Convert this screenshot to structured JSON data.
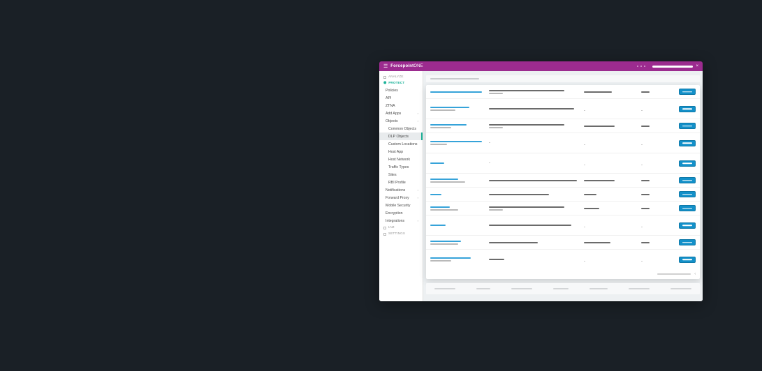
{
  "brand": {
    "bold": "Forcepoint",
    "light": "ONE"
  },
  "sections": {
    "analyze": "ANALYZE",
    "protect": "PROTECT",
    "iam": "IAM",
    "settings": "SETTINGS"
  },
  "nav": {
    "policies": "Policies",
    "api": "API",
    "ztna": "ZTNA",
    "addapps": "Add Apps",
    "objects": "Objects",
    "common": "Common Objects",
    "dlp": "DLP Objects",
    "custom": "Custom Locations",
    "hostapp": "Host App",
    "hostnetwork": "Host Network",
    "traffic": "Traffic Types",
    "sites": "Sites",
    "rbi": "RBI Profile",
    "notifications": "Notifications",
    "forwardproxy": "Forward Proxy",
    "mobilesec": "Mobile Security",
    "encryption": "Encryption",
    "integrations": "Integrations"
  },
  "colors": {
    "brand": "#9c2b8f",
    "accent": "#1eb39a",
    "link": "#36a3d9",
    "button": "#1390c9"
  },
  "rows": [
    {
      "c1": [
        {
          "c": "blue",
          "w": 74
        }
      ],
      "c2": [
        {
          "c": "gray",
          "w": 108
        },
        {
          "c": "light",
          "w": 20
        }
      ],
      "c3": {
        "type": "skel",
        "w": 40
      },
      "c4": {
        "type": "skel",
        "w": 12
      }
    },
    {
      "c1": [
        {
          "c": "blue",
          "w": 56
        },
        {
          "c": "light",
          "w": 36
        }
      ],
      "c2": [
        {
          "c": "gray",
          "w": 122
        }
      ],
      "c3": {
        "type": "dash"
      },
      "c4": {
        "type": "dash"
      }
    },
    {
      "c1": [
        {
          "c": "blue",
          "w": 52
        },
        {
          "c": "light",
          "w": 30
        }
      ],
      "c2": [
        {
          "c": "gray",
          "w": 108
        },
        {
          "c": "light",
          "w": 20
        }
      ],
      "c3": {
        "type": "skel",
        "w": 44
      },
      "c4": {
        "type": "skel",
        "w": 12
      }
    },
    {
      "c1": [
        {
          "c": "blue",
          "w": 74
        },
        {
          "c": "light",
          "w": 24
        }
      ],
      "c2": [],
      "c3": {
        "type": "dash"
      },
      "c4": {
        "type": "dash"
      },
      "c2dash": true
    },
    {
      "c1": [
        {
          "c": "blue",
          "w": 20
        }
      ],
      "c2": [],
      "c3": {
        "type": "dash"
      },
      "c4": {
        "type": "dash"
      },
      "c2dash": true
    },
    {
      "c1": [
        {
          "c": "blue",
          "w": 40
        },
        {
          "c": "light",
          "w": 50
        }
      ],
      "c2": [
        {
          "c": "gray",
          "w": 126
        }
      ],
      "c3": {
        "type": "skel",
        "w": 44
      },
      "c4": {
        "type": "skel",
        "w": 12
      }
    },
    {
      "c1": [
        {
          "c": "blue",
          "w": 16
        }
      ],
      "c2": [
        {
          "c": "gray",
          "w": 86
        }
      ],
      "c3": {
        "type": "skel",
        "w": 18
      },
      "c4": {
        "type": "skel",
        "w": 12
      }
    },
    {
      "c1": [
        {
          "c": "blue",
          "w": 28
        },
        {
          "c": "light",
          "w": 40
        }
      ],
      "c2": [
        {
          "c": "gray",
          "w": 108
        },
        {
          "c": "light",
          "w": 20
        }
      ],
      "c3": {
        "type": "skel",
        "w": 22
      },
      "c4": {
        "type": "skel",
        "w": 12
      }
    },
    {
      "c1": [
        {
          "c": "blue",
          "w": 22
        }
      ],
      "c2": [
        {
          "c": "gray",
          "w": 118
        }
      ],
      "c3": {
        "type": "dash"
      },
      "c4": {
        "type": "dash"
      }
    },
    {
      "c1": [
        {
          "c": "blue",
          "w": 44
        },
        {
          "c": "light",
          "w": 40
        }
      ],
      "c2": [
        {
          "c": "gray",
          "w": 70
        }
      ],
      "c3": {
        "type": "skel",
        "w": 38
      },
      "c4": {
        "type": "skel",
        "w": 12
      }
    },
    {
      "c1": [
        {
          "c": "blue",
          "w": 58
        },
        {
          "c": "light",
          "w": 30
        }
      ],
      "c2": [
        {
          "c": "gray",
          "w": 22
        }
      ],
      "c3": {
        "type": "dash"
      },
      "c4": {
        "type": "dash"
      }
    }
  ]
}
